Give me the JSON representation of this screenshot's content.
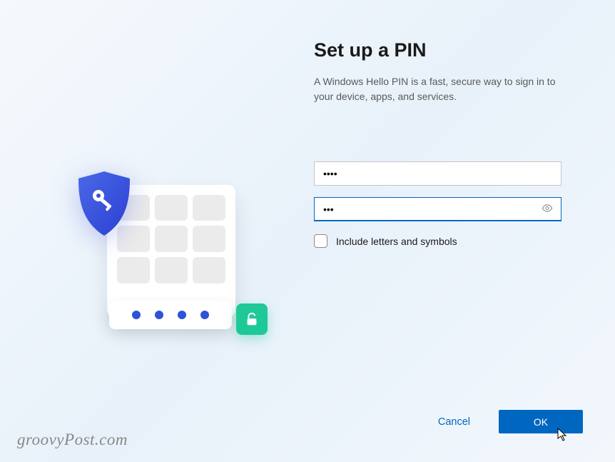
{
  "title": "Set up a PIN",
  "subtitle": "A Windows Hello PIN is a fast, secure way to sign in to your device, apps, and services.",
  "pin_value_display": "••••",
  "pin_confirm_display": "•••",
  "checkbox_label": "Include letters and symbols",
  "buttons": {
    "cancel": "Cancel",
    "ok": "OK"
  },
  "watermark": "groovyPost.com"
}
